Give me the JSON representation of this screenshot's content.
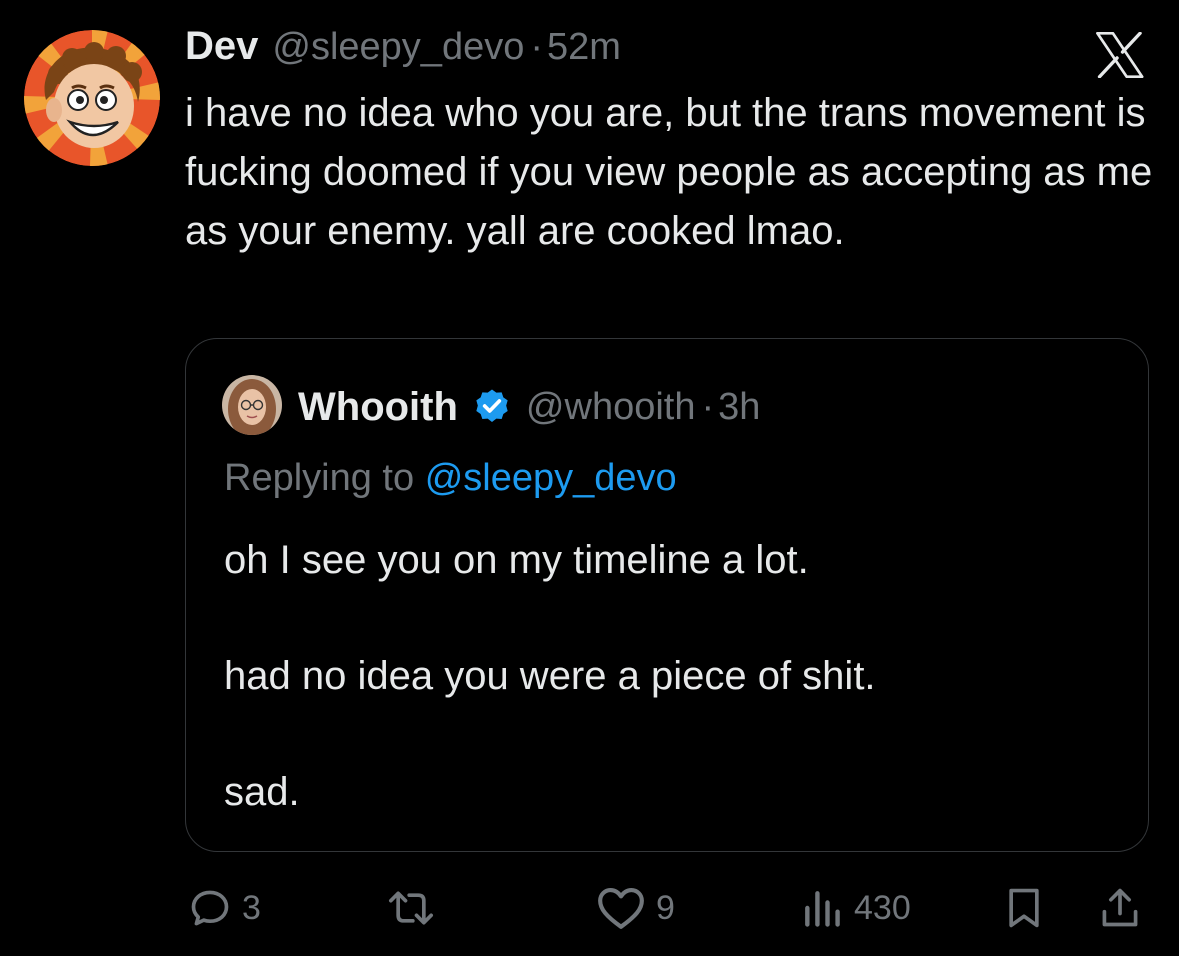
{
  "tweet": {
    "author_name": "Dev",
    "author_handle": "@sleepy_devo",
    "time": "52m",
    "separator": "·",
    "text": "i have no idea who you are, but the trans movement is fucking doomed if you view people as accepting as me as your enemy. yall are cooked lmao."
  },
  "quote": {
    "author_name": "Whooith",
    "author_handle": "@whooith",
    "separator": "·",
    "time": "3h",
    "replying_prefix": "Replying to",
    "replying_handle": "@sleepy_devo",
    "body": [
      "oh I see you on my timeline a lot.",
      "had no idea you were a piece of shit.",
      "sad."
    ]
  },
  "actions": {
    "replies": "3",
    "likes": "9",
    "views": "430"
  },
  "colors": {
    "background": "#000000",
    "text": "#e7e9ea",
    "secondary": "#71767b",
    "link": "#1d9bf0",
    "border": "#333639"
  },
  "icons": [
    "x-logo-icon",
    "verified-badge-icon",
    "reply-icon",
    "retweet-icon",
    "like-icon",
    "views-icon",
    "bookmark-icon",
    "share-icon"
  ]
}
